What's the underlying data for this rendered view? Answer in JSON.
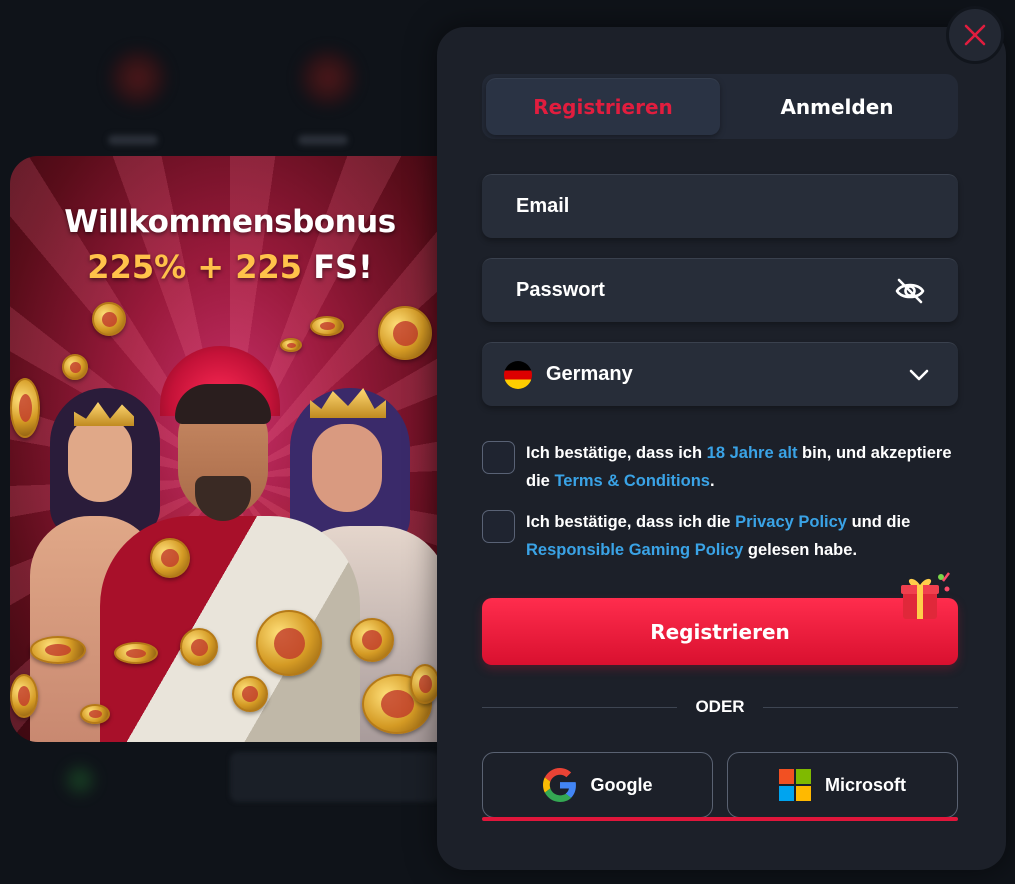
{
  "promo": {
    "title": "Willkommensbonus",
    "bonus_percent": "225%",
    "bonus_plus": "+",
    "bonus_fs_number": "225",
    "bonus_fs_label": "FS!"
  },
  "tabs": [
    {
      "label": "Registrieren",
      "active": true
    },
    {
      "label": "Anmelden",
      "active": false
    }
  ],
  "form": {
    "email_placeholder": "Email",
    "password_placeholder": "Passwort",
    "country": "Germany",
    "consent1": {
      "pre": "Ich bestätige, dass ich ",
      "link1": "18 Jahre alt",
      "mid": " bin, und akzeptiere die ",
      "link2": "Terms & Conditions",
      "post": "."
    },
    "consent2": {
      "pre": "Ich bestätige, dass ich die ",
      "link1": "Privacy Policy",
      "mid": " und die ",
      "link2": "Responsible Gaming Policy",
      "post": " gelesen habe."
    },
    "submit_label": "Registrieren",
    "or_label": "ODER"
  },
  "social": [
    {
      "label": "Google",
      "icon": "google-icon"
    },
    {
      "label": "Microsoft",
      "icon": "microsoft-icon"
    }
  ],
  "colors": {
    "accent": "#e11d3e",
    "link": "#3aa3e6",
    "modal_bg": "#1c2029"
  }
}
